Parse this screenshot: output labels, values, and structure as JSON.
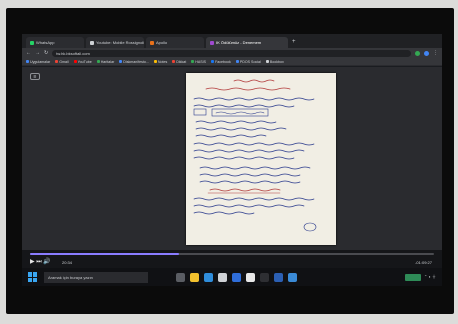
{
  "browser": {
    "tabs": [
      {
        "label": "WhatsApp",
        "color": "#25d366",
        "active": false
      },
      {
        "label": "Youtube: Mobile Rossignolius",
        "color": "#cfd2d6",
        "active": false
      },
      {
        "label": "Apollo",
        "color": "#e8711a",
        "active": false
      },
      {
        "label": "IK Ödülümüz - Denemem",
        "color": "#a04ad0",
        "active": true
      }
    ],
    "new_tab_label": "+",
    "url": "tw.hk.bksoftall.com",
    "bookmarks": [
      {
        "label": "Uygulamalar",
        "color": "#4285f4"
      },
      {
        "label": "Gmail",
        "color": "#ea4335"
      },
      {
        "label": "YouTube",
        "color": "#ff0000"
      },
      {
        "label": "Haritalar",
        "color": "#34a853"
      },
      {
        "label": "Diskmanifesto...",
        "color": "#4285f4"
      },
      {
        "label": "Notes",
        "color": "#fbbc05"
      },
      {
        "label": "Dikkat",
        "color": "#ea4335"
      },
      {
        "label": "HASIS",
        "color": "#34a853"
      },
      {
        "label": "Facebook",
        "color": "#1877f2"
      },
      {
        "label": "PDOS Social",
        "color": "#4285f4"
      },
      {
        "label": "Bookbox",
        "color": "#cfd2d6"
      }
    ]
  },
  "video": {
    "elapsed": "20:34",
    "remaining": "-01:09:27",
    "progress": 0.37
  },
  "taskbar": {
    "search_placeholder": "Aramak için buraya yazın",
    "icons": [
      {
        "name": "task-view-icon",
        "color": "#5a5d63"
      },
      {
        "name": "file-explorer-icon",
        "color": "#f2c12e"
      },
      {
        "name": "edge-icon",
        "color": "#2f8ddb"
      },
      {
        "name": "store-icon",
        "color": "#cfd2d6"
      },
      {
        "name": "mail-icon",
        "color": "#2f6edb"
      },
      {
        "name": "chrome-icon",
        "color": "#e8e8e8"
      },
      {
        "name": "video-player-icon",
        "color": "#2e2f33"
      },
      {
        "name": "word-icon",
        "color": "#2b5fb3"
      },
      {
        "name": "app-icon",
        "color": "#3a8ad6"
      }
    ]
  }
}
